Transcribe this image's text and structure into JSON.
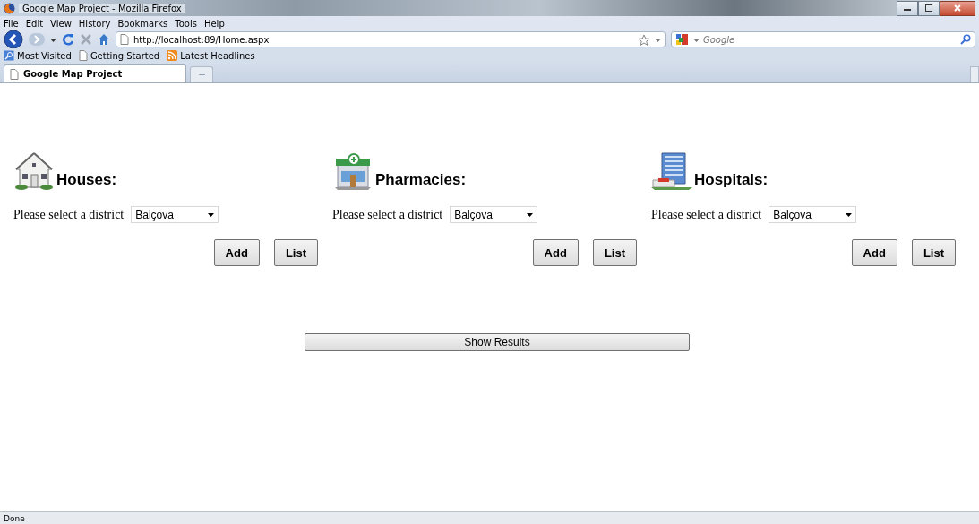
{
  "window": {
    "title": "Google Map Project - Mozilla Firefox"
  },
  "menu": [
    "File",
    "Edit",
    "View",
    "History",
    "Bookmarks",
    "Tools",
    "Help"
  ],
  "address": {
    "value": "http://localhost:89/Home.aspx"
  },
  "search": {
    "placeholder": "Google"
  },
  "bookmarks": [
    {
      "label": "Most Visited",
      "kind": "search"
    },
    {
      "label": "Getting Started",
      "kind": "page"
    },
    {
      "label": "Latest Headlines",
      "kind": "feed"
    }
  ],
  "tabs": [
    {
      "label": "Google Map Project",
      "selected": true
    }
  ],
  "sections": [
    {
      "kind": "house",
      "heading": "Houses:",
      "prompt": "Please select a district",
      "district": "Balçova",
      "buttons": [
        "Add",
        "List"
      ]
    },
    {
      "kind": "pharmacy",
      "heading": "Pharmacies:",
      "prompt": "Please select a district",
      "district": "Balçova",
      "buttons": [
        "Add",
        "List"
      ]
    },
    {
      "kind": "hospital",
      "heading": "Hospitals:",
      "prompt": "Please select a district",
      "district": "Balçova",
      "buttons": [
        "Add",
        "List"
      ]
    }
  ],
  "show_results": "Show Results",
  "status_bar": "Done"
}
